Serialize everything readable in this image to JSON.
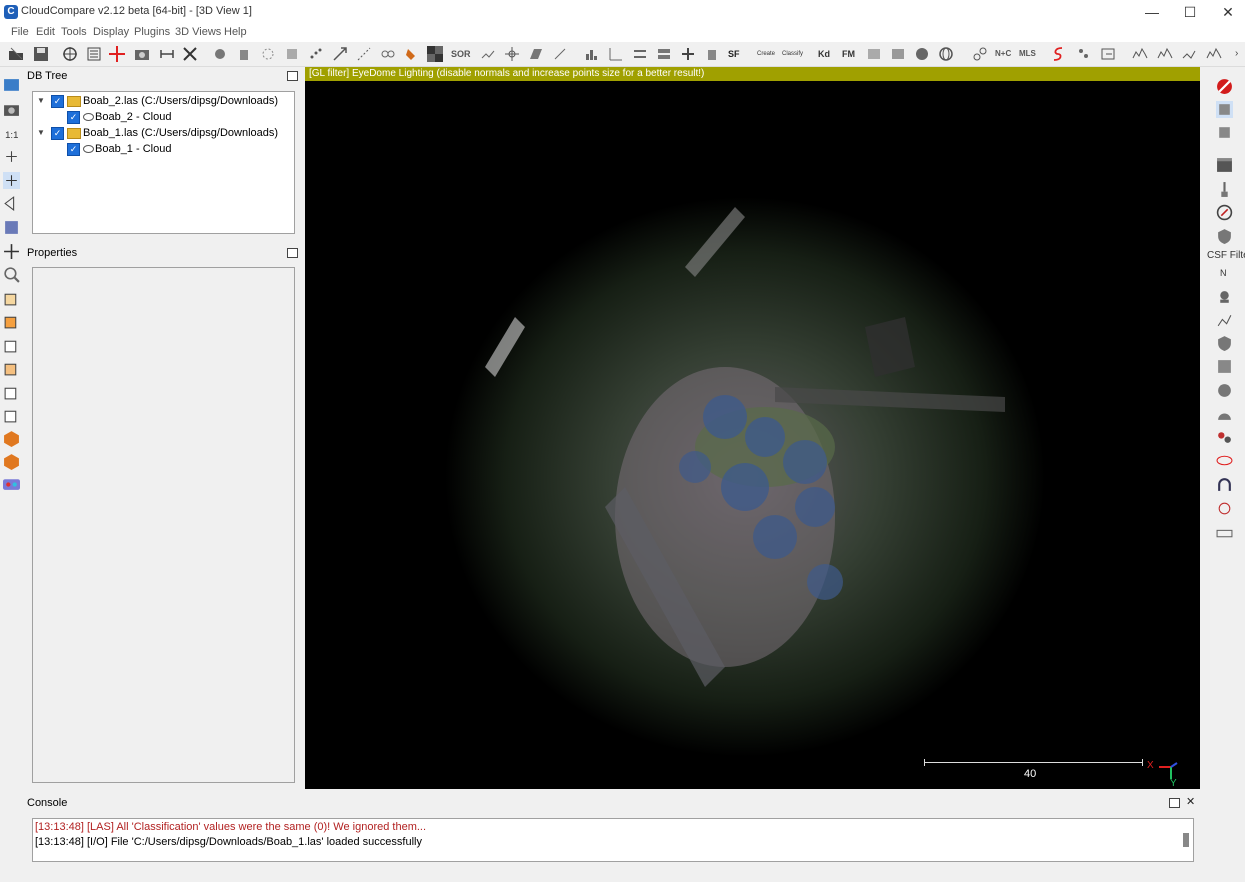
{
  "window": {
    "title": "CloudCompare v2.12 beta [64-bit] - [3D View 1]",
    "app_icon_letter": "C",
    "minimize": "—",
    "maximize": "☐",
    "close": "✕"
  },
  "menu": [
    "File",
    "Edit",
    "Tools",
    "Display",
    "Plugins",
    "3D Views",
    "Help"
  ],
  "toolbar": {
    "labels": {
      "sor": "SOR",
      "sf": "SF",
      "canupo_create": "Create",
      "canupo_classify": "Classify",
      "kd": "Kd",
      "fm": "FM",
      "mls": "MLS",
      "nc": "N+C"
    }
  },
  "db_tree": {
    "title": "DB Tree",
    "items": [
      {
        "label": "Boab_2.las (C:/Users/dipsg/Downloads)"
      },
      {
        "label": "Boab_2 - Cloud"
      },
      {
        "label": "Boab_1.las (C:/Users/dipsg/Downloads)"
      },
      {
        "label": "Boab_1 - Cloud"
      }
    ]
  },
  "properties": {
    "title": "Properties"
  },
  "view": {
    "banner": "[GL filter] EyeDome Lighting (disable normals and increase points size for a better result!)",
    "scale_label": "40",
    "axis_x": "X",
    "axis_y": "Y"
  },
  "right_panel": {
    "csf_label": "CSF Filter",
    "n_label": "N"
  },
  "console": {
    "title": "Console",
    "lines": [
      {
        "text": "[13:13:48] [LAS] All 'Classification' values were the same (0)! We ignored them...",
        "color": "#b22222"
      },
      {
        "text": "[13:13:48] [I/O] File 'C:/Users/dipsg/Downloads/Boab_1.las' loaded successfully",
        "color": "#000000"
      }
    ]
  },
  "colors": {
    "gl_banner": "#a0a000",
    "checkbox": "#1e6fd9",
    "error_text": "#b22222",
    "axis_x": "#e02020",
    "axis_y": "#20c060"
  }
}
